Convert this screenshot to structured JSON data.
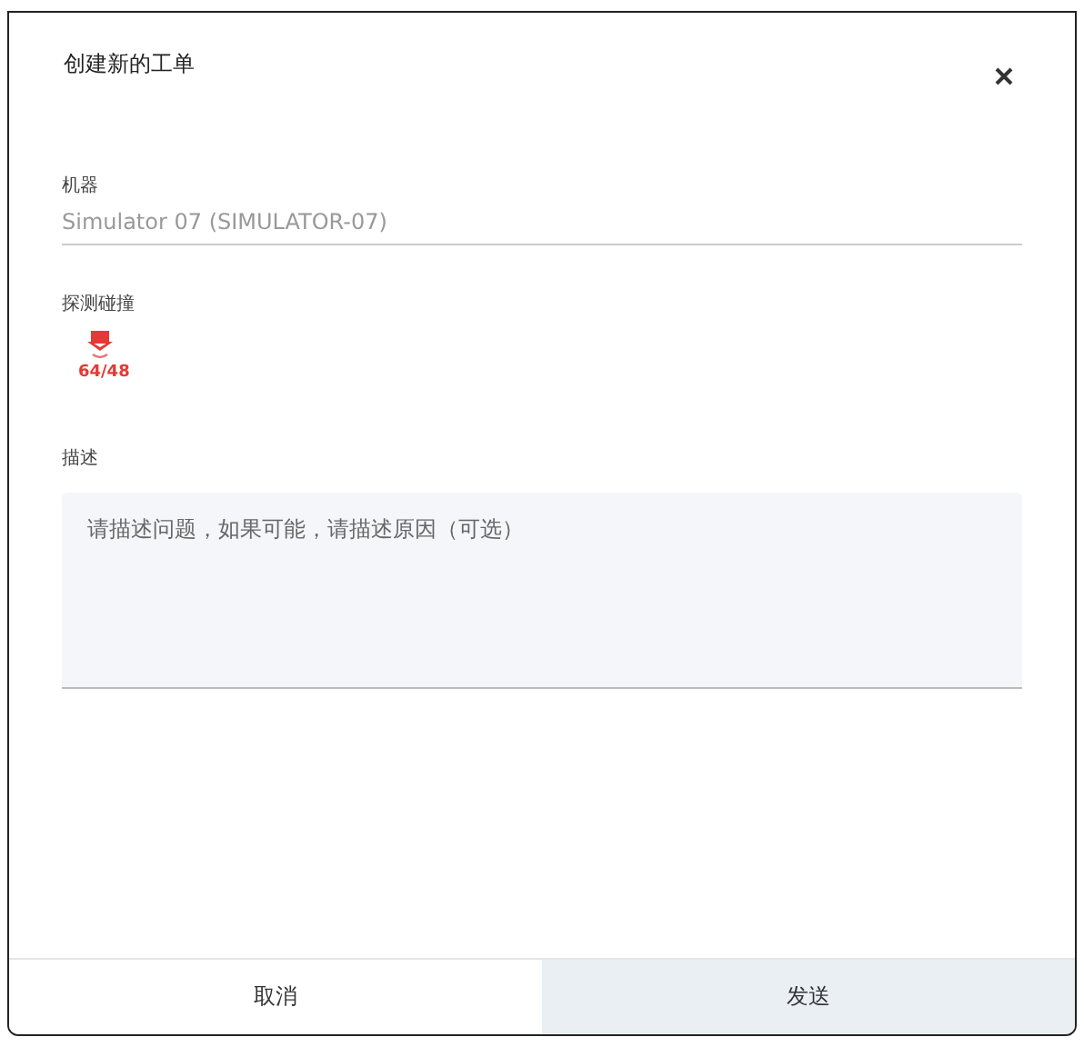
{
  "dialog": {
    "title": "创建新的工单"
  },
  "machine": {
    "label": "机器",
    "value": "Simulator 07 (SIMULATOR-07)"
  },
  "collision": {
    "label": "探测碰撞",
    "reading": "64/48"
  },
  "description": {
    "label": "描述",
    "placeholder": "请描述问题，如果可能，请描述原因（可选）"
  },
  "buttons": [
    {
      "label": "取消",
      "kind": "secondary"
    },
    {
      "label": "发送",
      "kind": "primary"
    }
  ]
}
